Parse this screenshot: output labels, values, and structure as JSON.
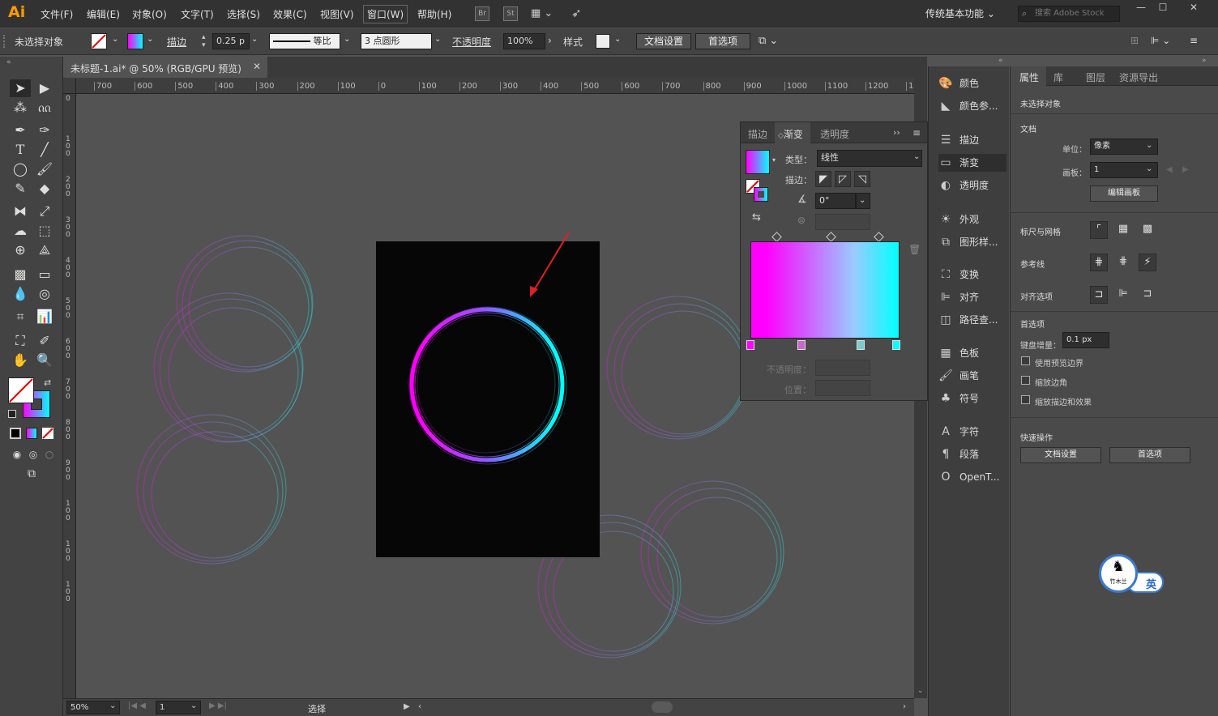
{
  "app": {
    "logo": "Ai"
  },
  "menu": [
    "文件(F)",
    "编辑(E)",
    "对象(O)",
    "文字(T)",
    "选择(S)",
    "效果(C)",
    "视图(V)",
    "窗口(W)",
    "帮助(H)"
  ],
  "menu_icons": {
    "br": "Br",
    "st": "St"
  },
  "workspace": "传统基本功能",
  "search_placeholder": "搜索 Adobe Stock",
  "control": {
    "selection": "未选择对象",
    "stroke_label": "描边",
    "stroke_value": "0.25 p",
    "profile": "等比",
    "brush": "3 点圆形",
    "opacity_label": "不透明度",
    "opacity_value": "100%",
    "style_label": "样式",
    "doc_setup": "文档设置",
    "prefs": "首选项"
  },
  "document_tab": "未标题-1.ai* @ 50% (RGB/GPU 预览)",
  "ruler_h": [
    "700",
    "600",
    "500",
    "400",
    "300",
    "200",
    "100",
    "0",
    "100",
    "200",
    "300",
    "400",
    "500",
    "600",
    "700",
    "800",
    "900",
    "1000",
    "1100",
    "1200",
    "13"
  ],
  "ruler_v": [
    "0",
    "1 0 0",
    "2 0 0",
    "3 0 0",
    "4 0 0",
    "5 0 0",
    "6 0 0",
    "7 0 0",
    "8 0 0",
    "9 0 0",
    "1 0 0",
    "1 0 0",
    "1 0 0"
  ],
  "status": {
    "zoom": "50%",
    "page": "1",
    "tool": "选择"
  },
  "gradient_panel": {
    "tabs": [
      "描边",
      "渐变",
      "透明度"
    ],
    "type_label": "类型：",
    "type_value": "线性",
    "stroke_label": "描边：",
    "angle_value": "0°",
    "opacity_label": "不透明度：",
    "location_label": "位置："
  },
  "collapsed_panels": [
    "颜色",
    "颜色参...",
    "描边",
    "渐变",
    "透明度",
    "外观",
    "图形样...",
    "变换",
    "对齐",
    "路径查...",
    "色板",
    "画笔",
    "符号",
    "字符",
    "段落",
    "OpenT..."
  ],
  "properties": {
    "tabs": [
      "属性",
      "库",
      "图层",
      "资源导出"
    ],
    "no_selection": "未选择对象",
    "document": "文档",
    "units_label": "单位：",
    "units_value": "像素",
    "artboard_label": "画板：",
    "artboard_value": "1",
    "edit_artboard": "编辑画板",
    "rulers_grids": "标尺与网格",
    "guides": "参考线",
    "snap_options": "对齐选项",
    "preferences": "首选项",
    "keyboard_increment_label": "键盘增量：",
    "keyboard_increment_value": "0.1 px",
    "checkbox_preview_bounds": "使用预览边界",
    "checkbox_scale_corners": "缩放边角",
    "checkbox_scale_strokes": "缩放描边和效果",
    "quick_actions": "快速操作",
    "doc_setup_btn": "文档设置",
    "prefs_btn": "首选项"
  },
  "ime": {
    "badge": "英",
    "seal": "竹木兰"
  },
  "colors": {
    "magenta": "#ff00ff",
    "cyan": "#00ffff",
    "artboard": "#060606",
    "canvas": "#535353",
    "arrow": "#e0201e"
  }
}
